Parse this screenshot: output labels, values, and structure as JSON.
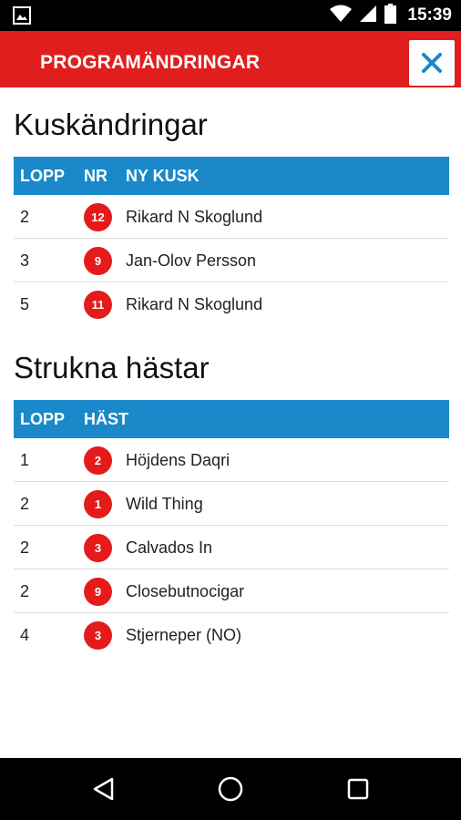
{
  "status_bar": {
    "time": "15:39",
    "icons": [
      "gallery-icon",
      "wifi-icon",
      "signal-icon",
      "battery-icon"
    ]
  },
  "app_bar": {
    "title": "PROGRAMÄNDRINGAR",
    "close_icon": "close-icon",
    "background_color": "#e01e1e",
    "close_color": "#1a88c9"
  },
  "driver_changes": {
    "title": "Kuskändringar",
    "headers": [
      "LOPP",
      "NR",
      "NY KUSK"
    ],
    "rows": [
      {
        "lopp": "2",
        "nr": "12",
        "name": "Rikard N Skoglund"
      },
      {
        "lopp": "3",
        "nr": "9",
        "name": "Jan-Olov Persson"
      },
      {
        "lopp": "5",
        "nr": "11",
        "name": "Rikard N Skoglund"
      }
    ]
  },
  "scratched_horses": {
    "title": "Strukna hästar",
    "headers": [
      "LOPP",
      "HÄST"
    ],
    "rows": [
      {
        "lopp": "1",
        "nr": "2",
        "name": "Höjdens Daqri"
      },
      {
        "lopp": "2",
        "nr": "1",
        "name": "Wild Thing"
      },
      {
        "lopp": "2",
        "nr": "3",
        "name": "Calvados In"
      },
      {
        "lopp": "2",
        "nr": "9",
        "name": "Closebutnocigar"
      },
      {
        "lopp": "4",
        "nr": "3",
        "name": "Stjerneper (NO)"
      }
    ]
  },
  "colors": {
    "table_header": "#1a88c9",
    "badge": "#e51b1b"
  },
  "nav_bar": {
    "icons": [
      "back-icon",
      "home-icon",
      "recents-icon"
    ]
  }
}
